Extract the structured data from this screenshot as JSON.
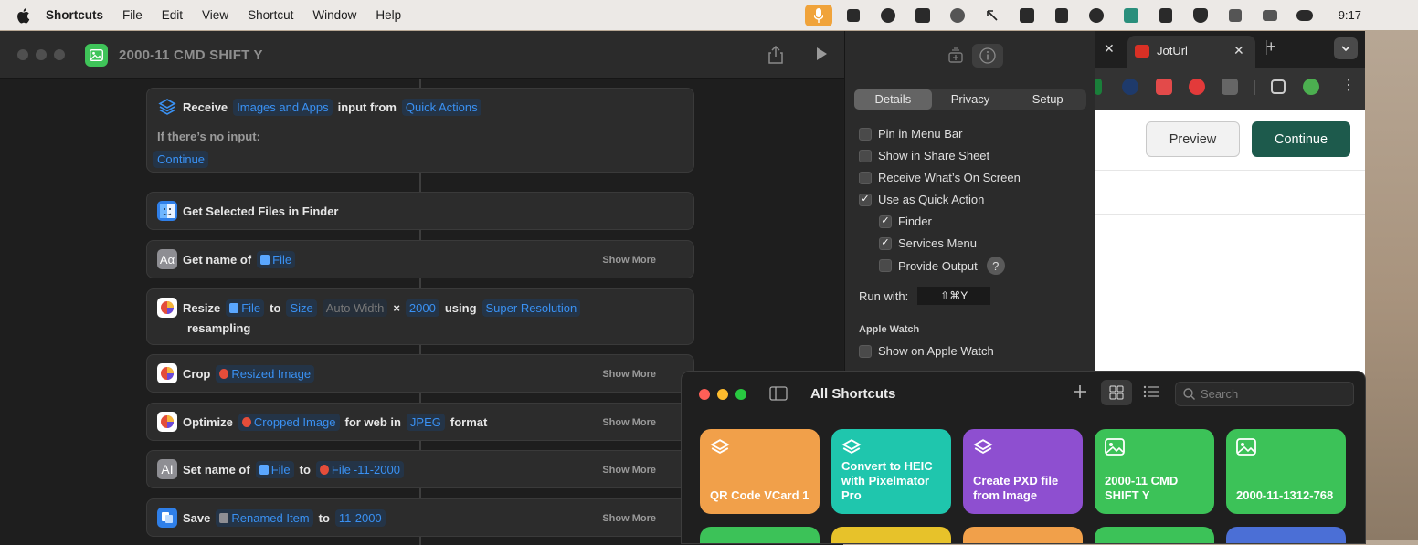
{
  "menubar": {
    "app": "Shortcuts",
    "items": [
      "File",
      "Edit",
      "View",
      "Shortcut",
      "Window",
      "Help"
    ],
    "time": "9:17"
  },
  "window": {
    "title": "2000-11 CMD SHIFT Y"
  },
  "actions": {
    "receive": {
      "verb": "Receive",
      "types": "Images and Apps",
      "mid": "input from",
      "source": "Quick Actions",
      "no_input_label": "If there’s no input:",
      "no_input_action": "Continue"
    },
    "get_files": {
      "text": "Get Selected Files in Finder"
    },
    "get_name": {
      "verb": "Get name of",
      "param": "File",
      "more": "Show More"
    },
    "resize": {
      "verb": "Resize",
      "param": "File",
      "to": "to",
      "size": "Size",
      "width": "Auto Width",
      "x": "×",
      "height": "2000",
      "using": "using",
      "method": "Super Resolution",
      "tail": "resampling"
    },
    "crop": {
      "verb": "Crop",
      "param": "Resized Image",
      "more": "Show More"
    },
    "optimize": {
      "verb": "Optimize",
      "param": "Cropped Image",
      "mid": "for web in",
      "format": "JPEG",
      "tail": "format",
      "more": "Show More"
    },
    "set_name": {
      "verb": "Set name of",
      "param": "File",
      "to": "to",
      "value_a": "File",
      "value_b": "-11-2000",
      "more": "Show More"
    },
    "save": {
      "verb": "Save",
      "param": "Renamed Item",
      "to": "to",
      "dest": "11-2000",
      "more": "Show More"
    }
  },
  "inspector": {
    "tabs": [
      "Details",
      "Privacy",
      "Setup"
    ],
    "options": {
      "pin_menu": "Pin in Menu Bar",
      "share_sheet": "Show in Share Sheet",
      "on_screen": "Receive What’s On Screen",
      "quick_action": "Use as Quick Action",
      "finder": "Finder",
      "services": "Services Menu",
      "provide_output": "Provide Output",
      "apple_watch_show": "Show on Apple Watch"
    },
    "help": "?",
    "run_with_label": "Run with:",
    "shortcut_keys": "⇧⌘Y",
    "apple_watch_header": "Apple Watch"
  },
  "browser": {
    "tab_title": "JotUrl",
    "close": "✕",
    "new_tab": "+",
    "preview": "Preview",
    "continue": "Continue"
  },
  "all_shortcuts": {
    "title": "All Shortcuts",
    "search_placeholder": "Search",
    "tiles": [
      {
        "name": "QR Code VCard 1",
        "color": "#f1a04a"
      },
      {
        "name": "Convert to HEIC with Pixelmator Pro",
        "color": "#1fc6ad"
      },
      {
        "name": "Create PXD file from Image",
        "color": "#8e4fd0"
      },
      {
        "name": "2000-11 CMD SHIFT Y",
        "color": "#3cc258"
      },
      {
        "name": "2000-11-1312-768",
        "color": "#3cc258"
      }
    ],
    "row2_colors": [
      "#3cc258",
      "#e7c22a",
      "#f1a04a",
      "#3cc258",
      "#4b6fd6"
    ]
  }
}
